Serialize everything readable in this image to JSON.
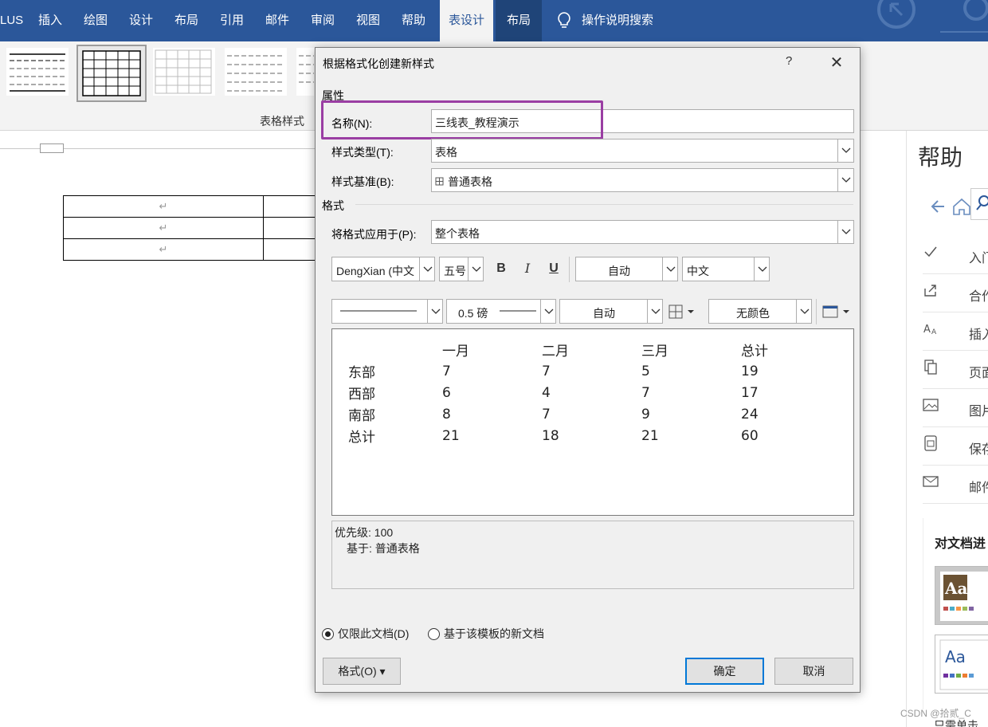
{
  "ribbon": {
    "tabs": [
      {
        "label": "LUS"
      },
      {
        "label": "插入"
      },
      {
        "label": "绘图"
      },
      {
        "label": "设计"
      },
      {
        "label": "布局"
      },
      {
        "label": "引用"
      },
      {
        "label": "邮件"
      },
      {
        "label": "审阅"
      },
      {
        "label": "视图"
      },
      {
        "label": "帮助"
      },
      {
        "label": "表设计"
      },
      {
        "label": "布局"
      }
    ],
    "tell_me": "操作说明搜索",
    "group_label": "表格样式"
  },
  "document": {
    "table_rows": [
      {
        "c1": "↵"
      },
      {
        "c1": "↵"
      },
      {
        "c1": "↵"
      }
    ]
  },
  "help_pane": {
    "title": "帮助",
    "items": [
      {
        "label": "入门",
        "icon": "check-icon"
      },
      {
        "label": "合作",
        "icon": "share-icon"
      },
      {
        "label": "插入",
        "icon": "font-icon"
      },
      {
        "label": "页面",
        "icon": "pages-icon"
      },
      {
        "label": "图片",
        "icon": "image-icon"
      },
      {
        "label": "保存",
        "icon": "save-icon"
      },
      {
        "label": "邮件",
        "icon": "mail-icon"
      }
    ],
    "card_title": "对文档进",
    "footer_text": "只需单击"
  },
  "dialog": {
    "title": "根据格式化创建新样式",
    "help": "?",
    "close": "✕",
    "properties_label": "属性",
    "name_label": "名称(N):",
    "name_value": "三线表_教程演示",
    "style_type_label": "样式类型(T):",
    "style_type_value": "表格",
    "style_based_label": "样式基准(B):",
    "style_based_value": "普通表格",
    "format_label": "格式",
    "apply_to_label": "将格式应用于(P):",
    "apply_to_value": "整个表格",
    "font_name": "DengXian (中文",
    "font_size": "五号",
    "bold": "B",
    "italic": "I",
    "underline": "U",
    "font_color": "自动",
    "script": "中文",
    "border_width": "0.5 磅",
    "border_color": "自动",
    "shading": "无颜色",
    "preview": {
      "header": [
        "",
        "一月",
        "二月",
        "三月",
        "总计"
      ],
      "rows": [
        [
          "东部",
          "7",
          "7",
          "5",
          "19"
        ],
        [
          "西部",
          "6",
          "4",
          "7",
          "17"
        ],
        [
          "南部",
          "8",
          "7",
          "9",
          "24"
        ],
        [
          "总计",
          "21",
          "18",
          "21",
          "60"
        ]
      ]
    },
    "desc_line1": "优先级: 100",
    "desc_line2": "基于: 普通表格",
    "radio_doc_only": "仅限此文档(D)",
    "radio_template": "基于该模板的新文档",
    "format_button": "格式(O) ▾",
    "ok_button": "确定",
    "cancel_button": "取消"
  },
  "watermark": "CSDN @拾贰_C",
  "colors": {
    "ribbon_blue": "#2b579a",
    "highlight_purple": "#9a3ea3",
    "primary_border": "#0078d7"
  }
}
